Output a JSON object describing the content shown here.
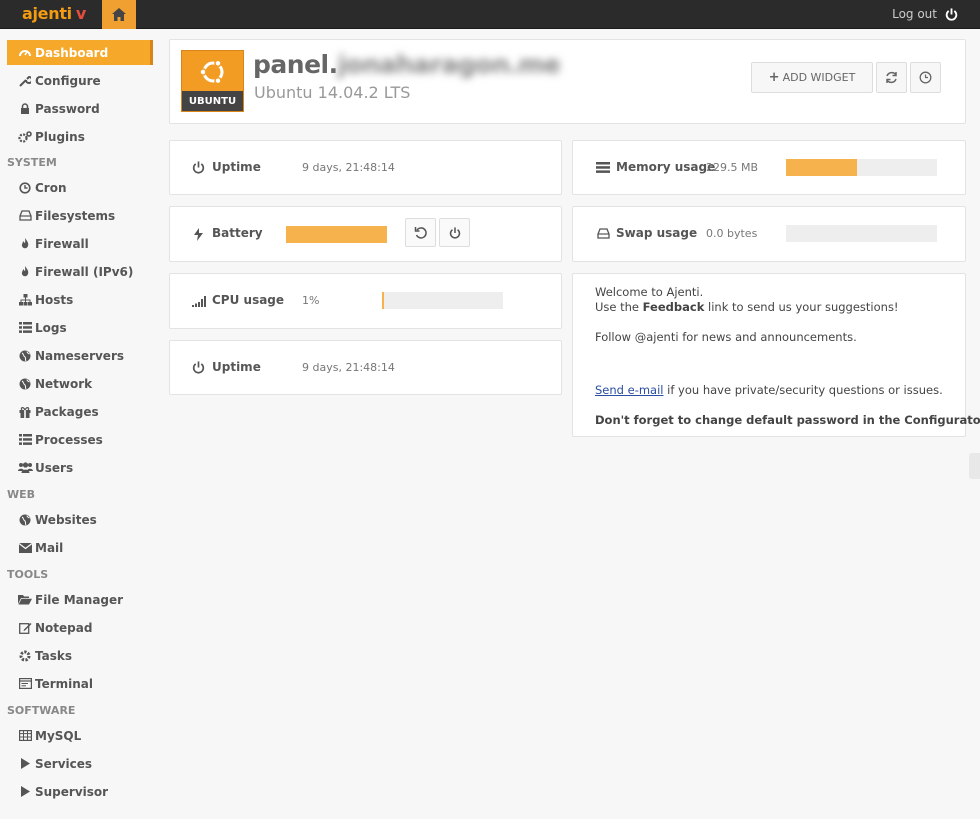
{
  "app": {
    "brand": "ajenti",
    "brand_mark": "v",
    "logout_label": "Log out"
  },
  "sidebar": {
    "items": [
      {
        "label": "Dashboard",
        "icon": "dashboard-icon",
        "active": true
      },
      {
        "label": "Configure",
        "icon": "wrench-icon"
      },
      {
        "label": "Password",
        "icon": "lock-icon"
      },
      {
        "label": "Plugins",
        "icon": "cogs-icon"
      }
    ],
    "sections": [
      {
        "title": "SYSTEM",
        "items": [
          {
            "label": "Cron",
            "icon": "clock-icon"
          },
          {
            "label": "Filesystems",
            "icon": "hdd-icon"
          },
          {
            "label": "Firewall",
            "icon": "fire-icon"
          },
          {
            "label": "Firewall (IPv6)",
            "icon": "fire-icon"
          },
          {
            "label": "Hosts",
            "icon": "sitemap-icon"
          },
          {
            "label": "Logs",
            "icon": "list-icon"
          },
          {
            "label": "Nameservers",
            "icon": "globe-icon"
          },
          {
            "label": "Network",
            "icon": "globe-icon"
          },
          {
            "label": "Packages",
            "icon": "gift-icon"
          },
          {
            "label": "Processes",
            "icon": "list-icon"
          },
          {
            "label": "Users",
            "icon": "users-icon"
          }
        ]
      },
      {
        "title": "WEB",
        "items": [
          {
            "label": "Websites",
            "icon": "globe-icon"
          },
          {
            "label": "Mail",
            "icon": "envelope-icon"
          }
        ]
      },
      {
        "title": "TOOLS",
        "items": [
          {
            "label": "File Manager",
            "icon": "folder-icon"
          },
          {
            "label": "Notepad",
            "icon": "edit-icon"
          },
          {
            "label": "Tasks",
            "icon": "cog-icon"
          },
          {
            "label": "Terminal",
            "icon": "terminal-icon"
          }
        ]
      },
      {
        "title": "SOFTWARE",
        "items": [
          {
            "label": "MySQL",
            "icon": "table-icon"
          },
          {
            "label": "Services",
            "icon": "play-icon"
          },
          {
            "label": "Supervisor",
            "icon": "play-icon"
          }
        ]
      }
    ]
  },
  "host": {
    "name_prefix": "panel.",
    "name_hidden": "jonaharagon.me",
    "os_version": "Ubuntu 14.04.2 LTS",
    "os_badge": "UBUNTU",
    "add_widget_label": "ADD WIDGET"
  },
  "widgets": {
    "uptime1": {
      "label": "Uptime",
      "value": "9 days, 21:48:14"
    },
    "battery": {
      "label": "Battery",
      "level": 1.0
    },
    "cpu": {
      "label": "CPU usage",
      "value": "1%",
      "level": 0.01
    },
    "uptime2": {
      "label": "Uptime",
      "value": "9 days, 21:48:14"
    },
    "memory": {
      "label": "Memory usage",
      "value": "229.5 MB",
      "level": 0.47
    },
    "swap": {
      "label": "Swap usage",
      "value": "0.0 bytes",
      "level": 0.0
    }
  },
  "welcome": {
    "line1": "Welcome to Ajenti.",
    "line2_pre": "Use the ",
    "line2_bold": "Feedback",
    "line2_post": " link to send us your suggestions!",
    "line3": "Follow @ajenti for news and announcements.",
    "line4_link": "Send e-mail",
    "line4_post": " if you have private/security questions or issues.",
    "line5": "Don't forget to change default password in the Configurator!"
  },
  "colors": {
    "accent": "#f6a82b",
    "topbar": "#2b2b2b",
    "bar_fill": "#f6b24c"
  }
}
